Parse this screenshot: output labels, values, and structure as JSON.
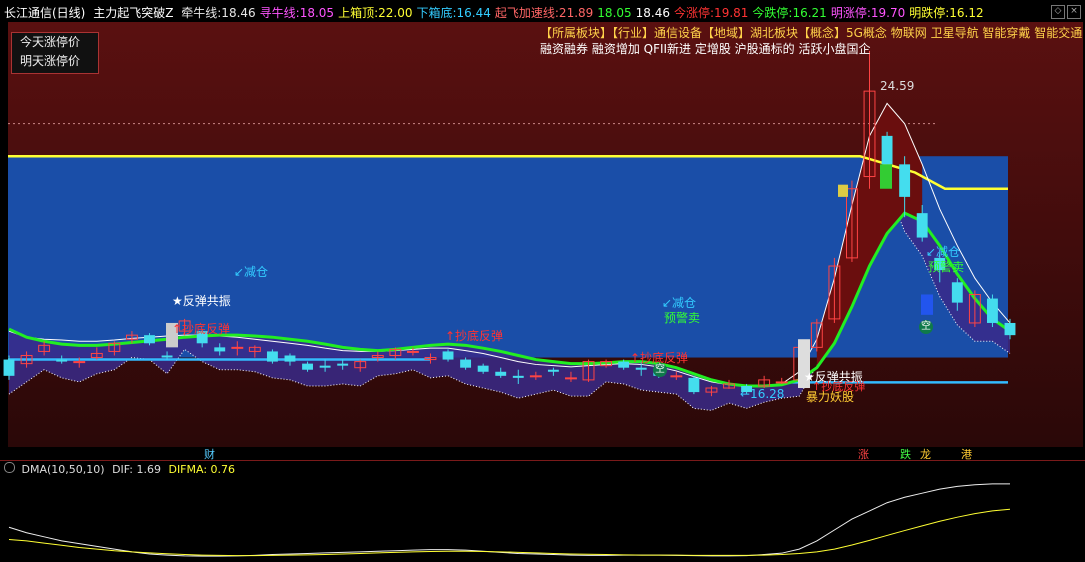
{
  "header": {
    "stock": "长江通信(日线)",
    "indicator": "主力起飞突破Z",
    "items": [
      {
        "label": "牵牛线:",
        "value": "18.46",
        "color": "#e6e6e6"
      },
      {
        "label": "寻牛线:",
        "value": "18.05",
        "color": "#ff55ff"
      },
      {
        "label": "上箱顶:",
        "value": "22.00",
        "color": "#ffff33"
      },
      {
        "label": "下箱底:",
        "value": "16.44",
        "color": "#33ccff"
      },
      {
        "label": "起飞加速线:",
        "value": "21.89",
        "color": "#ff6666"
      },
      {
        "label": "",
        "value": "18.05",
        "color": "#33ff33"
      },
      {
        "label": "",
        "value": "18.46",
        "color": "#ffffff"
      },
      {
        "label": "今涨停:",
        "value": "19.81",
        "color": "#ff3333"
      },
      {
        "label": "今跌停:",
        "value": "16.21",
        "color": "#33ff33"
      },
      {
        "label": "明涨停:",
        "value": "19.70",
        "color": "#ff55ff"
      },
      {
        "label": "明跌停:",
        "value": "16.12",
        "color": "#ffff33"
      }
    ]
  },
  "legend": {
    "today": "今天涨停价",
    "tomorrow": "明天涨停价"
  },
  "sectors": {
    "line1": "【所属板块】【行业】通信设备【地域】湖北板块【概念】5G概念 物联网 卫星导航 智能穿戴 智能交通",
    "line2": "融资融券 融资增加 QFII新进 定增股 沪股通标的 活跃小盘国企"
  },
  "annotations": {
    "rebound1": "★反弹共振",
    "bottom1": "↑抄底反弹",
    "reduce1": "↙减仓",
    "bottom2": "↑抄底反弹",
    "reduce2": "↙减仓",
    "warn_sell": "预警卖",
    "kong1": "空",
    "bottom3": "↑抄底反弹",
    "low_price": "←16.28",
    "rebound2": "★反弹共振",
    "monster": "暴力妖股",
    "bottom4": "↑抄底反弹",
    "high_price": "24.59",
    "reduce3": "↙减仓",
    "warn_sell2": "预警卖",
    "kong2": "空"
  },
  "bottom_tags": {
    "cai": "财",
    "zhang": "涨",
    "die": "跌",
    "long": "龙",
    "gang": "港"
  },
  "dma": {
    "title": "DMA(10,50,10)",
    "dif_label": "DIF:",
    "dif": "1.69",
    "difma_label": "DIFMA:",
    "difma": "0.76"
  },
  "colors": {
    "box_blue": "#1a4ea8",
    "up": "#ff4444",
    "down": "#44ddee",
    "ma_green": "#22ee22",
    "box_top": "#ffff33",
    "box_bottom": "#33bbff"
  },
  "candles": [
    {
      "o": 17.0,
      "c": 16.6,
      "h": 17.1,
      "l": 16.5
    },
    {
      "o": 16.9,
      "c": 17.1,
      "h": 17.2,
      "l": 16.8
    },
    {
      "o": 17.2,
      "c": 17.35,
      "h": 17.45,
      "l": 17.1
    },
    {
      "o": 17.0,
      "c": 16.95,
      "h": 17.1,
      "l": 16.9
    },
    {
      "o": 16.95,
      "c": 16.95,
      "h": 17.05,
      "l": 16.8
    },
    {
      "o": 17.05,
      "c": 17.15,
      "h": 17.3,
      "l": 17.0
    },
    {
      "o": 17.2,
      "c": 17.4,
      "h": 17.45,
      "l": 17.1
    },
    {
      "o": 17.5,
      "c": 17.6,
      "h": 17.7,
      "l": 17.4
    },
    {
      "o": 17.6,
      "c": 17.4,
      "h": 17.65,
      "l": 17.35
    },
    {
      "o": 17.1,
      "c": 17.05,
      "h": 17.2,
      "l": 17.0
    },
    {
      "o": 17.7,
      "c": 17.95,
      "h": 18.0,
      "l": 17.6
    },
    {
      "o": 17.7,
      "c": 17.4,
      "h": 17.75,
      "l": 17.3
    },
    {
      "o": 17.3,
      "c": 17.2,
      "h": 17.4,
      "l": 17.1
    },
    {
      "o": 17.3,
      "c": 17.3,
      "h": 17.45,
      "l": 17.1
    },
    {
      "o": 17.2,
      "c": 17.3,
      "h": 17.35,
      "l": 17.05
    },
    {
      "o": 17.2,
      "c": 16.95,
      "h": 17.25,
      "l": 16.9
    },
    {
      "o": 17.1,
      "c": 16.95,
      "h": 17.15,
      "l": 16.85
    },
    {
      "o": 16.9,
      "c": 16.75,
      "h": 16.95,
      "l": 16.7
    },
    {
      "o": 16.85,
      "c": 16.8,
      "h": 17.0,
      "l": 16.7
    },
    {
      "o": 16.9,
      "c": 16.85,
      "h": 17.0,
      "l": 16.75
    },
    {
      "o": 16.8,
      "c": 16.95,
      "h": 17.0,
      "l": 16.7
    },
    {
      "o": 17.05,
      "c": 17.1,
      "h": 17.2,
      "l": 16.95
    },
    {
      "o": 17.1,
      "c": 17.25,
      "h": 17.3,
      "l": 17.0
    },
    {
      "o": 17.2,
      "c": 17.2,
      "h": 17.3,
      "l": 17.1
    },
    {
      "o": 17.0,
      "c": 17.05,
      "h": 17.15,
      "l": 16.9
    },
    {
      "o": 17.2,
      "c": 17.0,
      "h": 17.25,
      "l": 16.95
    },
    {
      "o": 17.0,
      "c": 16.8,
      "h": 17.05,
      "l": 16.75
    },
    {
      "o": 16.85,
      "c": 16.7,
      "h": 16.9,
      "l": 16.65
    },
    {
      "o": 16.7,
      "c": 16.6,
      "h": 16.8,
      "l": 16.55
    },
    {
      "o": 16.6,
      "c": 16.55,
      "h": 16.75,
      "l": 16.4
    },
    {
      "o": 16.6,
      "c": 16.6,
      "h": 16.7,
      "l": 16.5
    },
    {
      "o": 16.75,
      "c": 16.7,
      "h": 16.8,
      "l": 16.6
    },
    {
      "o": 16.55,
      "c": 16.55,
      "h": 16.7,
      "l": 16.45
    },
    {
      "o": 16.5,
      "c": 16.95,
      "h": 17.0,
      "l": 16.45
    },
    {
      "o": 16.85,
      "c": 16.95,
      "h": 17.0,
      "l": 16.8
    },
    {
      "o": 16.95,
      "c": 16.8,
      "h": 17.0,
      "l": 16.75
    },
    {
      "o": 16.8,
      "c": 16.75,
      "h": 16.95,
      "l": 16.6
    },
    {
      "o": 16.7,
      "c": 16.6,
      "h": 16.8,
      "l": 16.55
    },
    {
      "o": 16.6,
      "c": 16.6,
      "h": 16.7,
      "l": 16.5
    },
    {
      "o": 16.55,
      "c": 16.2,
      "h": 16.6,
      "l": 16.15
    },
    {
      "o": 16.2,
      "c": 16.3,
      "h": 16.35,
      "l": 16.1
    },
    {
      "o": 16.3,
      "c": 16.4,
      "h": 16.5,
      "l": 16.28
    },
    {
      "o": 16.35,
      "c": 16.2,
      "h": 16.4,
      "l": 16.15
    },
    {
      "o": 16.35,
      "c": 16.5,
      "h": 16.6,
      "l": 16.3
    },
    {
      "o": 16.45,
      "c": 16.45,
      "h": 16.55,
      "l": 16.4
    },
    {
      "o": 16.5,
      "c": 17.3,
      "h": 17.35,
      "l": 16.45
    },
    {
      "o": 17.3,
      "c": 17.9,
      "h": 18.0,
      "l": 17.2
    },
    {
      "o": 18.0,
      "c": 19.3,
      "h": 19.5,
      "l": 17.9
    },
    {
      "o": 19.5,
      "c": 21.2,
      "h": 21.4,
      "l": 19.4
    },
    {
      "o": 21.5,
      "c": 23.6,
      "h": 24.59,
      "l": 21.2
    },
    {
      "o": 22.5,
      "c": 21.8,
      "h": 22.6,
      "l": 21.6
    },
    {
      "o": 21.8,
      "c": 21.0,
      "h": 22.0,
      "l": 20.5
    },
    {
      "o": 20.6,
      "c": 20.0,
      "h": 20.8,
      "l": 19.9
    },
    {
      "o": 19.5,
      "c": 19.2,
      "h": 19.7,
      "l": 18.9
    },
    {
      "o": 18.9,
      "c": 18.4,
      "h": 19.0,
      "l": 18.2
    },
    {
      "o": 17.9,
      "c": 18.6,
      "h": 18.7,
      "l": 17.8
    },
    {
      "o": 18.5,
      "c": 17.9,
      "h": 18.6,
      "l": 17.8
    },
    {
      "o": 17.9,
      "c": 17.6,
      "h": 18.0,
      "l": 17.5
    }
  ],
  "ma_green": [
    17.75,
    17.55,
    17.45,
    17.38,
    17.35,
    17.35,
    17.38,
    17.42,
    17.46,
    17.5,
    17.55,
    17.58,
    17.6,
    17.6,
    17.58,
    17.55,
    17.5,
    17.45,
    17.38,
    17.3,
    17.25,
    17.22,
    17.25,
    17.3,
    17.35,
    17.38,
    17.35,
    17.28,
    17.2,
    17.1,
    17.0,
    16.95,
    16.9,
    16.9,
    16.92,
    16.95,
    16.95,
    16.9,
    16.8,
    16.65,
    16.5,
    16.4,
    16.35,
    16.35,
    16.38,
    16.5,
    16.8,
    17.4,
    18.3,
    19.3,
    20.1,
    20.6,
    20.4,
    19.8,
    19.1,
    18.5,
    18.0,
    17.7
  ],
  "ma_white": [
    17.7,
    17.55,
    17.5,
    17.48,
    17.45,
    17.45,
    17.48,
    17.52,
    17.55,
    17.58,
    17.6,
    17.6,
    17.58,
    17.55,
    17.5,
    17.45,
    17.4,
    17.35,
    17.28,
    17.22,
    17.2,
    17.2,
    17.22,
    17.25,
    17.28,
    17.28,
    17.22,
    17.15,
    17.05,
    16.95,
    16.88,
    16.85,
    16.82,
    16.85,
    16.88,
    16.9,
    16.88,
    16.82,
    16.72,
    16.58,
    16.45,
    16.38,
    16.35,
    16.36,
    16.4,
    16.7,
    17.5,
    19.0,
    20.8,
    22.5,
    23.3,
    22.8,
    21.8,
    20.7,
    19.8,
    19.0,
    18.4,
    17.9
  ]
}
